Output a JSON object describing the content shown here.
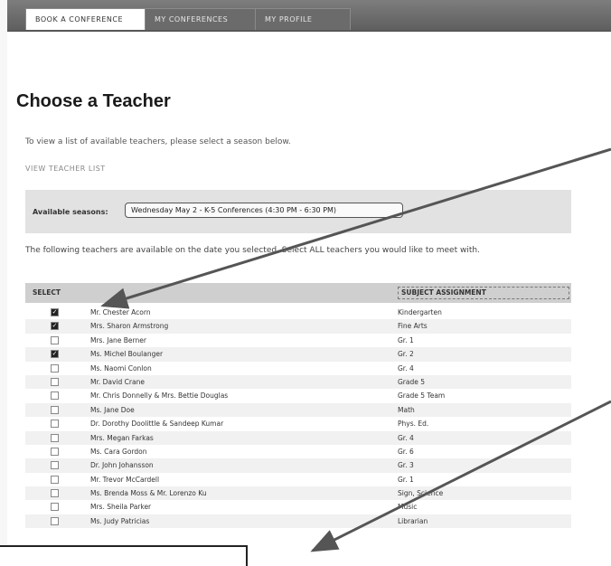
{
  "tabs": [
    {
      "label": "BOOK A CONFERENCE",
      "active": true
    },
    {
      "label": "MY CONFERENCES",
      "active": false
    },
    {
      "label": "MY PROFILE",
      "active": false
    }
  ],
  "page": {
    "title": "Choose a Teacher",
    "intro": "To view a list of available teachers, please select a season below.",
    "view_teacher_list": "VIEW TEACHER LIST"
  },
  "season": {
    "label": "Available seasons:",
    "selected": "Wednesday May 2 - K-5 Conferences (4:30 PM - 6:30 PM)"
  },
  "helper_text": "The following teachers are available on the date you selected. Select ALL teachers you would like to meet with.",
  "table": {
    "headers": {
      "select": "SELECT",
      "name": "",
      "subject": "SUBJECT ASSIGNMENT"
    },
    "rows": [
      {
        "checked": true,
        "name": "Mr. Chester Acorn",
        "subject": "Kindergarten"
      },
      {
        "checked": true,
        "name": "Mrs. Sharon Armstrong",
        "subject": "Fine Arts"
      },
      {
        "checked": false,
        "name": "Mrs. Jane Berner",
        "subject": "Gr. 1"
      },
      {
        "checked": true,
        "name": "Ms. Michel Boulanger",
        "subject": "Gr. 2"
      },
      {
        "checked": false,
        "name": "Ms. Naomi Conlon",
        "subject": "Gr. 4"
      },
      {
        "checked": false,
        "name": "Mr. David Crane",
        "subject": "Grade 5"
      },
      {
        "checked": false,
        "name": "Mr. Chris Donnelly & Mrs. Bettie Douglas",
        "subject": "Grade 5 Team"
      },
      {
        "checked": false,
        "name": "Ms. Jane Doe",
        "subject": "Math"
      },
      {
        "checked": false,
        "name": "Dr. Dorothy Doolittle & Sandeep Kumar",
        "subject": "Phys. Ed."
      },
      {
        "checked": false,
        "name": "Mrs. Megan Farkas",
        "subject": "Gr. 4"
      },
      {
        "checked": false,
        "name": "Ms. Cara Gordon",
        "subject": "Gr. 6"
      },
      {
        "checked": false,
        "name": "Dr. John Johansson",
        "subject": "Gr. 3"
      },
      {
        "checked": false,
        "name": "Mr. Trevor McCardell",
        "subject": "Gr. 1"
      },
      {
        "checked": false,
        "name": "Ms. Brenda Moss & Mr. Lorenzo Ku",
        "subject": "Sign, Science"
      },
      {
        "checked": false,
        "name": "Mrs. Sheila Parker",
        "subject": "Music"
      },
      {
        "checked": false,
        "name": "Ms. Judy Patricias",
        "subject": "Librarian"
      }
    ]
  },
  "colors": {
    "topbar": "#6b6b6b",
    "header_row": "#cfcfcf",
    "arrow": "#555555"
  }
}
